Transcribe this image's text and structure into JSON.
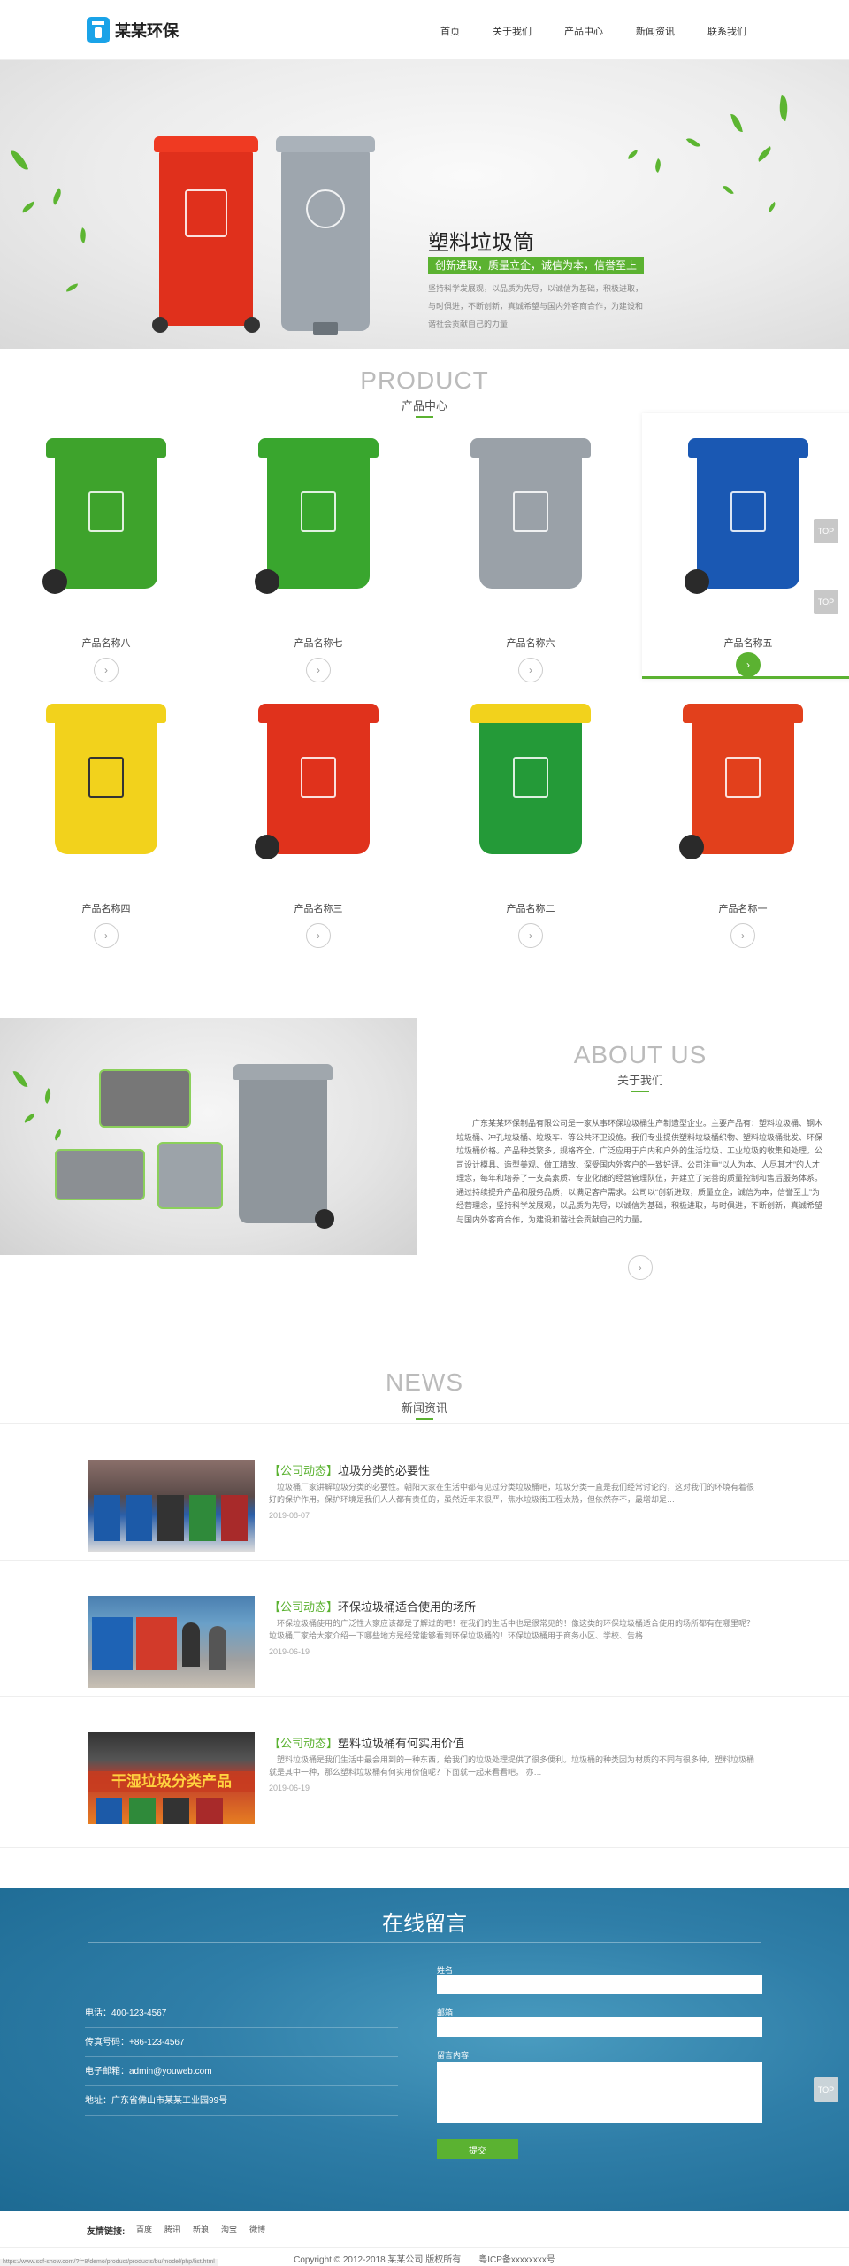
{
  "header": {
    "logo_text": "某某环保",
    "nav": [
      "首页",
      "关于我们",
      "产品中心",
      "新闻资讯",
      "联系我们"
    ]
  },
  "banner": {
    "title": "塑料垃圾筒",
    "tagline": "创新进取，质量立企，诚信为本，信誉至上",
    "description": "坚持科学发展观，以品质为先导，以诚信为基础，积极进取，与时俱进，不断创新，真诚希望与国内外客商合作，为建设和谐社会贡献自己的力量"
  },
  "products": {
    "title_en": "PRODUCT",
    "title_cn": "产品中心",
    "items": [
      {
        "name": "产品名称八",
        "color": "#3ea32c"
      },
      {
        "name": "产品名称七",
        "color": "#39a62e"
      },
      {
        "name": "产品名称六",
        "color": "#9aa1a8"
      },
      {
        "name": "产品名称五",
        "color": "#1a58b3"
      },
      {
        "name": "产品名称四",
        "color": "#f2d21c"
      },
      {
        "name": "产品名称三",
        "color": "#e0321c"
      },
      {
        "name": "产品名称二",
        "color": "#249a38"
      },
      {
        "name": "产品名称一",
        "color": "#e2401c"
      }
    ],
    "more_icon": "chevron-right-icon"
  },
  "top_button": "TOP",
  "about": {
    "title_en": "ABOUT US",
    "title_cn": "关于我们",
    "text": "广东某某环保制品有限公司是一家从事环保垃圾桶生产制造型企业。主要产品有：塑料垃圾桶、钢木垃圾桶、冲孔垃圾桶、垃圾车、等公共环卫设施。我们专业提供塑料垃圾桶织物、塑料垃圾桶批发、环保垃圾桶价格。产品种类繁多，规格齐全，广泛应用于户内和户外的生活垃圾、工业垃圾的收集和处理。公司设计模具、造型美观、做工精致、深受国内外客户的一致好评。公司注重“以人为本、人尽其才”的人才理念，每年和培养了一支高素质、专业化储的经营管理队伍，并建立了完善的质量控制和售后服务体系。通过持续提升产品和服务品质，以满足客户需求。公司以“创新进取，质量立企，诚信为本，信誉至上”为经营理念，坚持科学发展观，以品质为先导，以诚信为基础，积极进取，与时俱进，不断创新，真诚希望与国内外客商合作，为建设和谐社会贡献自己的力量。..."
  },
  "news": {
    "title_en": "NEWS",
    "title_cn": "新闻资讯",
    "items": [
      {
        "category": "【公司动态】",
        "title": "垃圾分类的必要性",
        "desc": "垃圾桶厂家讲解垃圾分类的必要性。朝阳大家在生活中都有见过分类垃圾桶吧，垃圾分类一直是我们经常讨论的，这对我们的环境有着很好的保护作用。保护环境是我们人人都有责任的，虽然近年来很严，焦水垃圾街工程太热，但依然存不，最增却是…",
        "date": "2019-08-07"
      },
      {
        "category": "【公司动态】",
        "title": "环保垃圾桶适合使用的场所",
        "desc": "环保垃圾桶使用的广泛性大家应该都是了解过的吧！在我们的生活中也是很常见的！像这类的环保垃圾桶适合使用的场所都有在哪里呢？垃圾桶厂家给大家介绍一下哪些地方是经常能够看到环保垃圾桶的！环保垃圾桶用于商务小区、学校、告格…",
        "date": "2019-06-19"
      },
      {
        "category": "【公司动态】",
        "title": "塑料垃圾桶有何实用价值",
        "desc": "塑料垃圾桶是我们生活中最会用到的一种东西，给我们的垃圾处理提供了很多便利。垃圾桶的种类因为材质的不同有很多种，塑料垃圾桶就是其中一种，那么塑料垃圾桶有何实用价值呢？下面就一起来看看吧。 亦…",
        "date": "2019-06-19"
      }
    ],
    "thumb3_text": "干湿垃圾分类产品"
  },
  "contact": {
    "title": "在线留言",
    "info": [
      {
        "label": "电话：",
        "value": "400-123-4567"
      },
      {
        "label": "传真号码：",
        "value": "+86-123-4567"
      },
      {
        "label": "电子邮箱：",
        "value": "admin@youweb.com"
      },
      {
        "label": "地址：",
        "value": "广东省佛山市某某工业园99号"
      }
    ],
    "form": {
      "name_label": "姓名",
      "email_label": "邮箱",
      "message_label": "留言内容",
      "submit": "提交"
    }
  },
  "footer": {
    "links_label": "友情链接:",
    "links": [
      "百度",
      "腾讯",
      "新浪",
      "淘宝",
      "微博"
    ],
    "copyright": "Copyright © 2012-2018 某某公司 版权所有　　粤ICP备xxxxxxxx号",
    "status_url": "https://www.sdf-show.com/?f=8/demo/product/products/bu/model/php/list.html"
  }
}
